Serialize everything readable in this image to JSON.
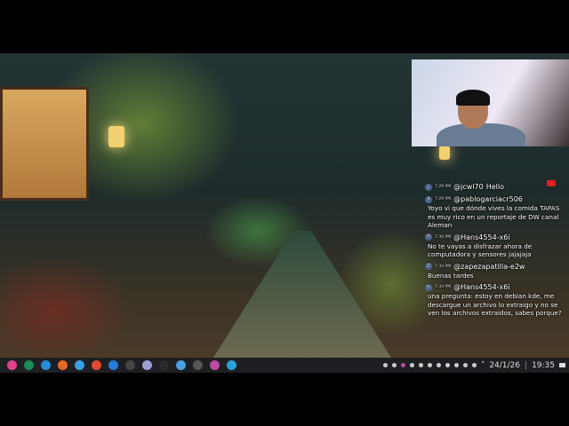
{
  "chat": {
    "messages": [
      {
        "time": "7:29 PM",
        "user": "@jcwl70",
        "text": "Hello",
        "avatar": "J"
      },
      {
        "time": "7:29 PM",
        "user": "@pablogarciacr506",
        "text": "Yoyo vi que dónde vives la comida TAPAS es muy rico en un reportaje de DW canal Aleman",
        "avatar": "P"
      },
      {
        "time": "7:30 PM",
        "user": "@Hans4554-x6i",
        "text": "No te vayas a disfrazar ahora de computadora y sensores jajajaja",
        "avatar": "H"
      },
      {
        "time": "7:34 PM",
        "user": "@zapezapatilla-e2w",
        "text": "Buenas tardes",
        "avatar": "Z"
      },
      {
        "time": "7:34 PM",
        "user": "@Hans4554-x6i",
        "text": "una pregunta: estoy en debian kde, me descargue un archivo lo extraigo y no se ven los archivos extraidos, sabes porque?",
        "avatar": "H"
      }
    ]
  },
  "taskbar": {
    "apps": [
      {
        "name": "debian-menu-icon",
        "color": "#e0408a"
      },
      {
        "name": "app-green-icon",
        "color": "#1d8a5a"
      },
      {
        "name": "dolphin-icon",
        "color": "#2a8ad8"
      },
      {
        "name": "firefox-icon",
        "color": "#e86a20"
      },
      {
        "name": "app-blue-icon",
        "color": "#3aa0e0"
      },
      {
        "name": "brave-icon",
        "color": "#e04a30"
      },
      {
        "name": "files-icon",
        "color": "#2a7ad8"
      },
      {
        "name": "terminal-icon",
        "color": "#444"
      },
      {
        "name": "ghost-icon",
        "color": "#9fa0d8"
      },
      {
        "name": "app-a-icon",
        "color": "#2a2a2a"
      },
      {
        "name": "app-globe-icon",
        "color": "#4aa0e0"
      },
      {
        "name": "obs-icon",
        "color": "#555"
      },
      {
        "name": "app-pink-icon",
        "color": "#c04aa0"
      },
      {
        "name": "telegram-icon",
        "color": "#2aa0d8"
      }
    ],
    "date": "24/1/26",
    "time": "19:35"
  }
}
